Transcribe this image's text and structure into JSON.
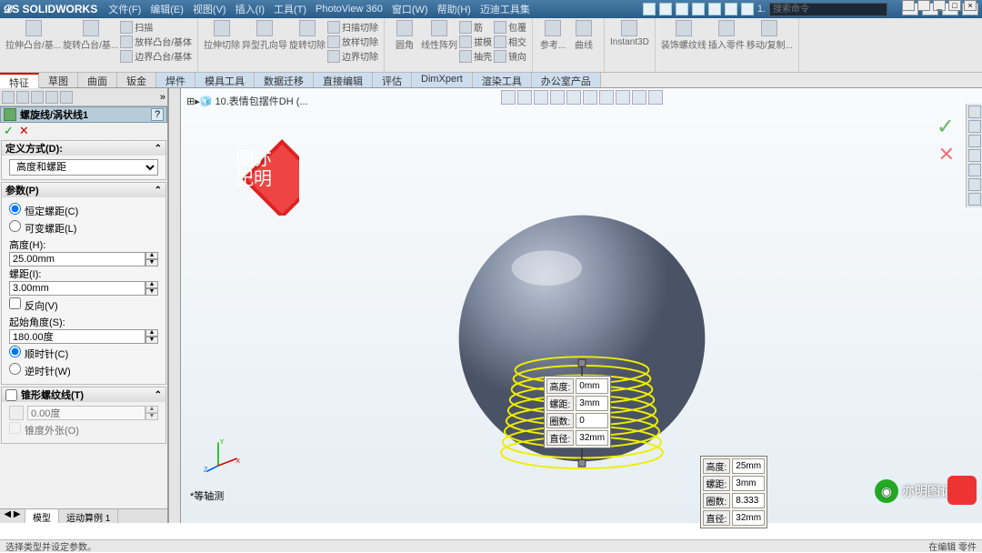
{
  "app": {
    "logo_text": "SOLIDWORKS",
    "menu": [
      "文件(F)",
      "编辑(E)",
      "视图(V)",
      "插入(I)",
      "工具(T)",
      "PhotoView 360",
      "窗口(W)",
      "帮助(H)",
      "迈迪工具集"
    ],
    "quick_last": "1.",
    "search_placeholder": "搜索命令",
    "min_label": "_",
    "mid_label": "-",
    "max_label": "□",
    "close_label": "×"
  },
  "ribbon": {
    "g1": [
      "拉伸凸台/基...",
      "旋转凸台/基..."
    ],
    "g1b": [
      "扫描",
      "放样凸台/基体",
      "边界凸台/基体"
    ],
    "g2": [
      "拉伸切除",
      "异型孔向导",
      "旋转切除"
    ],
    "g2b": [
      "扫描切除",
      "放样切除",
      "边界切除"
    ],
    "g3": [
      "圆角",
      "线性阵列"
    ],
    "g3b": [
      "筋",
      "拔模",
      "抽壳"
    ],
    "g3c": [
      "包覆",
      "相交",
      "镜向"
    ],
    "g4": [
      "参考...",
      "曲线"
    ],
    "g5": "Instant3D",
    "g6": [
      "装饰螺纹线",
      "插入零件",
      "移动/复制..."
    ]
  },
  "tabs": [
    "特征",
    "草图",
    "曲面",
    "钣金",
    "焊件",
    "模具工具",
    "数据迁移",
    "直接编辑",
    "评估",
    "DimXpert",
    "渲染工具",
    "办公室产品"
  ],
  "tabs_active_index": 0,
  "doc_title": "10.表情包摆件DH  (...",
  "pm": {
    "title": "螺旋线/涡状线1",
    "section_def": "定义方式(D):",
    "def_sel": "高度和螺距",
    "section_param": "参数(P)",
    "const_pitch": "恒定螺距(C)",
    "var_pitch": "可变螺距(L)",
    "height_lbl": "高度(H):",
    "height_val": "25.00mm",
    "pitch_lbl": "螺距(I):",
    "pitch_val": "3.00mm",
    "reverse": "反向(V)",
    "start_ang_lbl": "起始角度(S):",
    "start_ang_val": "180.00度",
    "cw": "顺时针(C)",
    "ccw": "逆时针(W)",
    "section_taper": "锥形螺纹线(T)",
    "taper_val": "0.00度",
    "taper_out": "锥度外张(O)"
  },
  "bottom_tabs": [
    "模型",
    "运动算例 1"
  ],
  "anno1": {
    "r1k": "高度:",
    "r1v": "0mm",
    "r2k": "螺距:",
    "r2v": "3mm",
    "r3k": "圈数:",
    "r3v": "0",
    "r4k": "直径:",
    "r4v": "32mm"
  },
  "anno2": {
    "r1k": "高度:",
    "r1v": "25mm",
    "r2k": "螺距:",
    "r2v": "3mm",
    "r3k": "圈数:",
    "r3v": "8.333",
    "r4k": "直径:",
    "r4v": "32mm"
  },
  "view_label": "*等轴测",
  "status_left": "选择类型并设定参数。",
  "status_right": "在编辑 零件",
  "watermark_text": "亦明图记",
  "ok_glyph": "✓",
  "close_glyph": "✕",
  "stamp_l1": "圖亦",
  "stamp_l2": "記明"
}
